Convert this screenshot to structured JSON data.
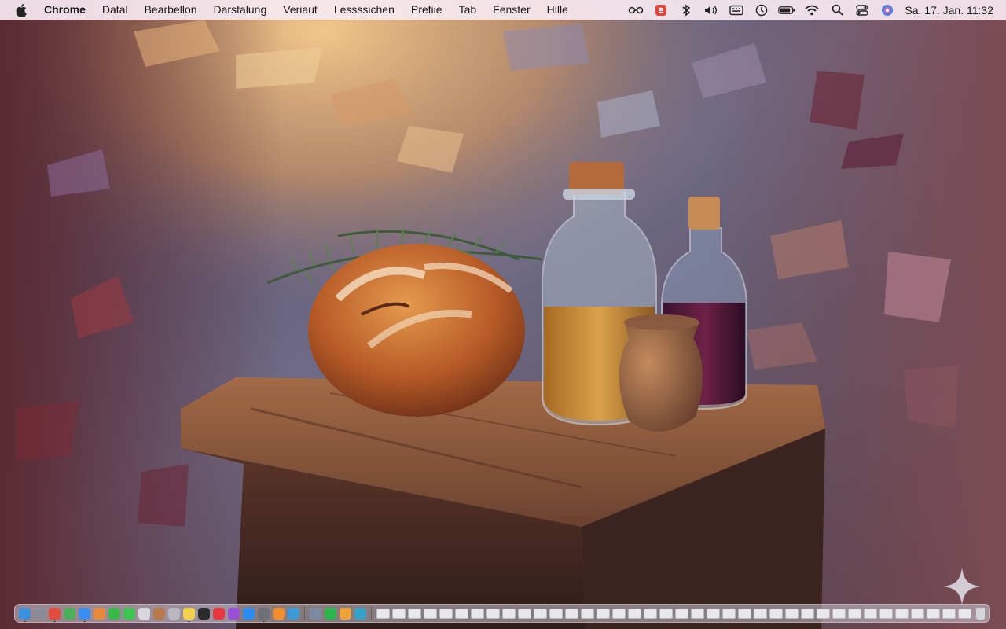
{
  "menubar": {
    "app_name": "Chrome",
    "items": [
      "Datal",
      "Bearbellon",
      "Darstalung",
      "Veriaut",
      "Lessssichen",
      "Prefiie",
      "Tab",
      "Fenster",
      "Hille"
    ],
    "status_icons": [
      "control-center-icon",
      "app-badge-icon",
      "bluetooth-icon",
      "volume-icon",
      "keyboard-input-icon",
      "screen-time-icon",
      "battery-icon",
      "wifi-icon",
      "spotlight-search-icon",
      "control-center-toggle-icon",
      "siri-icon"
    ],
    "clock": "Sa. 17. Jan.  11:32"
  },
  "colors": {
    "menubar_bg": "#f6e8f0",
    "badge_red": "#e2473d",
    "siri_blue": "#4d7fe0"
  },
  "dock": {
    "apps": [
      {
        "name": "finder",
        "color": "#3d8fe0",
        "running": true
      },
      {
        "name": "launchpad",
        "color": "#8a8d98",
        "running": false
      },
      {
        "name": "chrome",
        "color": "#e24c3a",
        "running": true
      },
      {
        "name": "maps",
        "color": "#4cb05a",
        "running": false
      },
      {
        "name": "mail",
        "color": "#3a8ef0",
        "running": true
      },
      {
        "name": "photos",
        "color": "#e58a3a",
        "running": false
      },
      {
        "name": "facetime",
        "color": "#38b84a",
        "running": false
      },
      {
        "name": "messages",
        "color": "#3ec551",
        "running": false
      },
      {
        "name": "vivaldi",
        "color": "#d9d9de",
        "running": false
      },
      {
        "name": "contacts",
        "color": "#b87a4a",
        "running": false
      },
      {
        "name": "terminal-app",
        "color": "#b8b8be",
        "running": false
      },
      {
        "name": "notes",
        "color": "#f4d24b",
        "running": true
      },
      {
        "name": "activity",
        "color": "#2b2b2b",
        "running": false
      },
      {
        "name": "news",
        "color": "#e8383e",
        "running": false
      },
      {
        "name": "podcasts",
        "color": "#9b4fd6",
        "running": false
      },
      {
        "name": "appstore",
        "color": "#2d8cf0",
        "running": false
      },
      {
        "name": "settings",
        "color": "#6f7077",
        "running": true
      },
      {
        "name": "pages",
        "color": "#f08d2e",
        "running": false
      },
      {
        "name": "mirror",
        "color": "#3d9ad6",
        "running": false
      }
    ],
    "apps2": [
      {
        "name": "preview",
        "color": "#7b8aa0",
        "running": false
      },
      {
        "name": "numbers",
        "color": "#2fb34d",
        "running": false
      },
      {
        "name": "keynote",
        "color": "#f0a23a",
        "running": false
      },
      {
        "name": "xcode",
        "color": "#35a2c8",
        "running": false
      }
    ],
    "minimized_count": 38
  }
}
